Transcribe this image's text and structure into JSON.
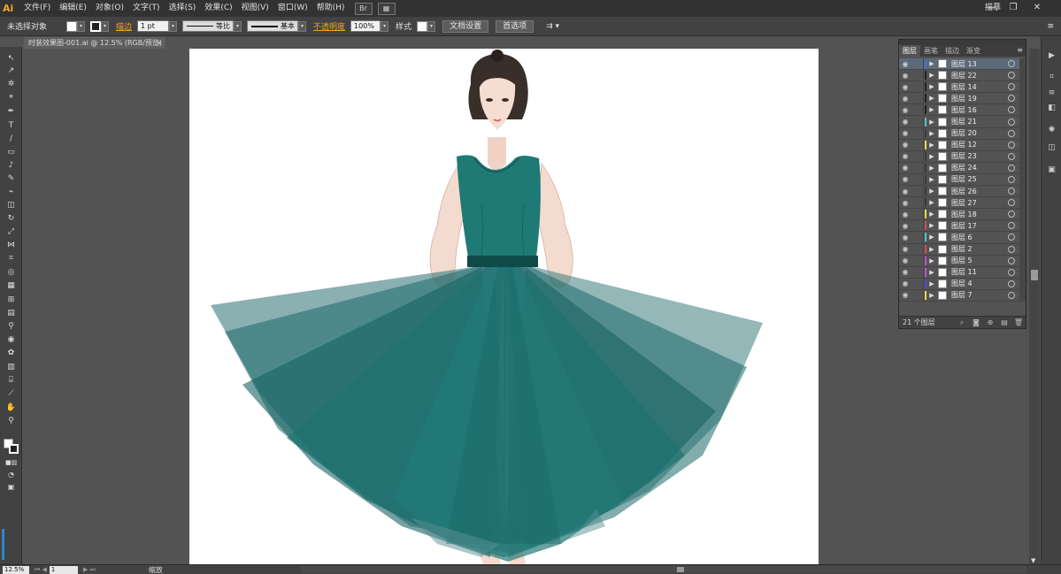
{
  "app": {
    "logo": "Ai",
    "workspace": "描摹",
    "window_controls": {
      "minimize": "—",
      "restore": "❐",
      "close": "✕"
    }
  },
  "menubar": {
    "items": [
      "文件(F)",
      "编辑(E)",
      "对象(O)",
      "文字(T)",
      "选择(S)",
      "效果(C)",
      "视图(V)",
      "窗口(W)",
      "帮助(H)"
    ],
    "icon_bridge": "Br",
    "icon_arrange": "▦"
  },
  "controlbar": {
    "selection_label": "未选择对象",
    "stroke_label": "描边",
    "stroke_weight": "1 pt",
    "profile_uniform": "等比",
    "brush_basic": "基本",
    "opacity_label": "不透明度",
    "opacity_value": "100%",
    "style_label": "样式",
    "doc_setup": "文档设置",
    "preferences": "首选项"
  },
  "document": {
    "tab_title": "时装效果图-001.ai @ 12.5% (RGB/预览)",
    "close": "×"
  },
  "layers_panel": {
    "tabs": [
      "图层",
      "画笔",
      "描边",
      "渐变"
    ],
    "active_tab": "图层",
    "count_label": "21 个图层",
    "rows": [
      {
        "name": "图层 13",
        "color": "#4a6fd8",
        "selected": true
      },
      {
        "name": "图层 22",
        "color": "#222222",
        "selected": false
      },
      {
        "name": "图层 14",
        "color": "#222222",
        "selected": false
      },
      {
        "name": "图层 19",
        "color": "#222222",
        "selected": false
      },
      {
        "name": "图层 16",
        "color": "#222222",
        "selected": false
      },
      {
        "name": "图层 21",
        "color": "#4fc3c9",
        "selected": false
      },
      {
        "name": "图层 20",
        "color": "#3a3a3a",
        "selected": false
      },
      {
        "name": "图层 12",
        "color": "#e6d84a",
        "selected": false
      },
      {
        "name": "图层 23",
        "color": "#3a3a3a",
        "selected": false
      },
      {
        "name": "图层 24",
        "color": "#3a3a3a",
        "selected": false
      },
      {
        "name": "图层 25",
        "color": "#3a3a3a",
        "selected": false
      },
      {
        "name": "图层 26",
        "color": "#3a3a3a",
        "selected": false
      },
      {
        "name": "图层 27",
        "color": "#3a3a3a",
        "selected": false
      },
      {
        "name": "图层 18",
        "color": "#e6d84a",
        "selected": false
      },
      {
        "name": "图层 17",
        "color": "#d84a4a",
        "selected": false
      },
      {
        "name": "图层 6",
        "color": "#4fc3c9",
        "selected": false
      },
      {
        "name": "图层 2",
        "color": "#d84a4a",
        "selected": false
      },
      {
        "name": "图层 5",
        "color": "#c84ad8",
        "selected": false
      },
      {
        "name": "图层 11",
        "color": "#c84ad8",
        "selected": false
      },
      {
        "name": "图层 4",
        "color": "#4a4ad8",
        "selected": false
      },
      {
        "name": "图层 7",
        "color": "#e6d84a",
        "selected": false
      }
    ]
  },
  "statusbar": {
    "zoom": "12.5%",
    "artboard_number": "1",
    "tool_status": "缩放"
  },
  "colors": {
    "dress": "#1e7471",
    "dress_dark": "#14504e",
    "belt": "#0f4a48",
    "skin": "#f5dcd0",
    "hair": "#3a2e2a"
  }
}
